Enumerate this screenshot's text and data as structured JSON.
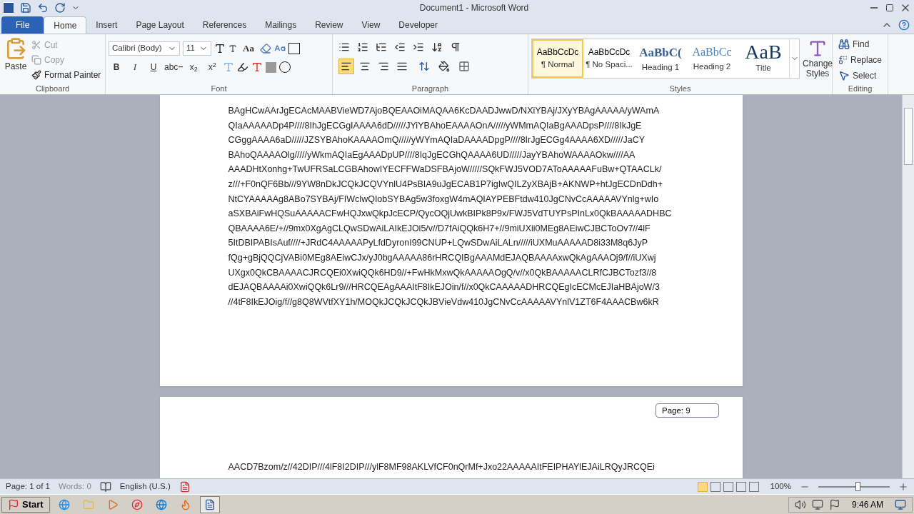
{
  "window": {
    "title": "Document1 - Microsoft Word"
  },
  "tabs": [
    {
      "label": "File",
      "kind": "file",
      "selected": false
    },
    {
      "label": "Home",
      "kind": "tab",
      "selected": true
    },
    {
      "label": "Insert",
      "kind": "tab",
      "selected": false
    },
    {
      "label": "Page Layout",
      "kind": "tab",
      "selected": false
    },
    {
      "label": "References",
      "kind": "tab",
      "selected": false
    },
    {
      "label": "Mailings",
      "kind": "tab",
      "selected": false
    },
    {
      "label": "Review",
      "kind": "tab",
      "selected": false
    },
    {
      "label": "View",
      "kind": "tab",
      "selected": false
    },
    {
      "label": "Developer",
      "kind": "tab",
      "selected": false
    }
  ],
  "clipboard": {
    "label": "Clipboard",
    "paste": "Paste",
    "items": [
      {
        "label": "Cut",
        "disabled": true
      },
      {
        "label": "Copy",
        "disabled": true
      },
      {
        "label": "Format Painter",
        "disabled": false
      }
    ]
  },
  "font": {
    "label": "Font",
    "font_name": "Calibri (Body)",
    "font_size": "11",
    "case_button": "Aa",
    "format_buttons": [
      {
        "label": "B",
        "kind": "bold"
      },
      {
        "label": "I",
        "kind": "italic"
      },
      {
        "label": "U",
        "kind": "underline"
      },
      {
        "label": "abc",
        "kind": "strike"
      },
      {
        "label": "x$_{2}$",
        "kind": "plain"
      },
      {
        "label": "x$^{2}$",
        "kind": "plain"
      }
    ]
  },
  "paragraph": {
    "label": "Paragraph",
    "alignment": [
      {
        "selected": true
      },
      {
        "selected": false
      },
      {
        "selected": false
      },
      {
        "selected": false
      }
    ]
  },
  "styles": {
    "label": "Styles",
    "items": [
      {
        "preview": "AaBbCcDc",
        "name": "¶ Normal",
        "kind": "normal",
        "selected": true
      },
      {
        "preview": "AaBbCcDc",
        "name": "¶ No Spaci...",
        "kind": "normal",
        "selected": false
      },
      {
        "preview": "AaBbC(",
        "name": "Heading 1",
        "kind": "heading1",
        "selected": false
      },
      {
        "preview": "AaBbCc",
        "name": "Heading 2",
        "kind": "heading2",
        "selected": false
      },
      {
        "preview": "AaB",
        "name": "Title",
        "kind": "title",
        "selected": false
      }
    ],
    "change_styles": "Change Styles"
  },
  "editing": {
    "label": "Editing",
    "items": [
      "Find",
      "Replace",
      "Select"
    ]
  },
  "document": {
    "pages": [
      {
        "lines": [
          "BAgHCwAArJgECAcMAABVieWD7AjoBQEAAOiMAQAA6KcDAADJwwD/NXiYBAj/JXyYBAgAAAAA/yWAmA",
          "QIaAAAAADp4P////8IhJgECGgIAAAA6dD/////JYiYBAhoEAAAAOnA/////yWMmAQIaBgAAADpsP////8IkJgE",
          "CGggAAAA6aD/////JZSYBAhoKAAAAOmQ/////yWYmAQIaDAAAADpgP////8IrJgECGg4AAAA6XD/////JaCY",
          "BAhoQAAAAOlg/////yWkmAQIaEgAAADpUP////8IqJgECGhQAAAA6UD/////JayYBAhoWAAAAOkw////AA",
          "AAADHtXonhg+TwUFRSaLCGBAhowIYECFFWaDSFBAjoW/////SQkFWJ5VOD7AToAAAAAFuBw+QTAACLk/",
          "z///+F0nQF6Bb///9YW8nDkJCQkJCQVYnlU4PsBIA9uJgECAB1P7igIwQILZyXBAjB+AKNWP+htJgECDnDdh+",
          "NtCYAAAAAg8ABo7SYBAj/FIWclwQIobSYBAg5w3foxgW4mAQIAYPEBFtdw410JgCNvCcAAAAAVYnlg+wIo",
          "aSXBAiFwHQSuAAAAACFwHQJxwQkpJcECP/QycOQjUwkBIPk8P9x/FWJ5VdTUYPsPInLx0QkBAAAAADHBC",
          "QBAAAA6E/+//9mx0XgAgCLQwSDwAiLAIkEJOi5/v//D7fAiQQk6H7+//9miUXii0MEg8AEiwCJBCToOv7//4lF",
          "5ItDBIPABIsAuf////+JRdC4AAAAAPyLfdDyronI99CNUP+LQwSDwAiLALn/////iUXMuAAAAAD8i33M8q6JyP",
          "fQg+gBjQQCjVABi0MEg8AEiwCJx/yJ0bgAAAAA86rHRCQIBgAAAMdEJAQBAAAAxwQkAgAAAOj9/f//iUXwj",
          "UXgx0QkCBAAAACJRCQEi0XwiQQk6HD9//+FwHkMxwQkAAAAAOgQ/v//x0QkBAAAAACLRfCJBCTozf3//8",
          "dEJAQBAAAAi0XwiQQk6Lr9///HRCQEAgAAAItF8IkEJOin/f//x0QkCAAAAADHRCQEgIcECMcEJIaHBAjoW/3",
          "//4tF8IkEJOig/f//g8Q8WVtfXY1h/MOQkJCQkJCQkJBVieVdw410JgCNvCcAAAAAVYnlV1ZT6F4AAACBw6kR"
        ]
      },
      {
        "lines": [
          "AACD7Bzom/z//42DIP///4lF8I2DIP///ylF8MF98AKLVfCF0nQrMf+Jxo22AAAAAItFEIPHAYlEJAiLRQyJRCQEi"
        ]
      }
    ],
    "page_tooltip": "Page: 9"
  },
  "status_bar": {
    "page": "Page: 1 of 1",
    "words": "Words: 0",
    "language": "English (U.S.)",
    "zoom": "100%",
    "zoom_level": {
      "level": 0.55
    }
  },
  "taskbar": {
    "start": "Start",
    "apps": [
      {
        "kind": "ie",
        "selected": false
      },
      {
        "kind": "folder",
        "selected": false
      },
      {
        "kind": "media",
        "selected": false
      },
      {
        "kind": "chrome",
        "selected": false
      },
      {
        "kind": "edge",
        "selected": false
      },
      {
        "kind": "firefox",
        "selected": false
      },
      {
        "kind": "word",
        "selected": true
      }
    ],
    "clock": "9:46 AM"
  }
}
